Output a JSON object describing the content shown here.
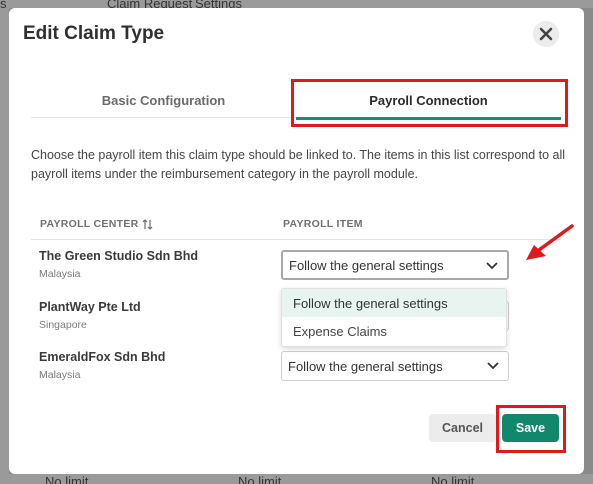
{
  "background": {
    "top_labels": [
      "s",
      "Claim Request",
      "Settings"
    ],
    "bottom_labels": [
      "No limit",
      "No limit",
      "No limit"
    ]
  },
  "modal": {
    "title": "Edit Claim Type",
    "close_icon": "close-icon"
  },
  "tabs": [
    {
      "label": "Basic Configuration",
      "active": false
    },
    {
      "label": "Payroll Connection",
      "active": true
    }
  ],
  "description": "Choose the payroll item this claim type should be linked to. The items in this list correspond to all payroll items under the reimbursement category in the payroll module.",
  "table": {
    "headers": {
      "payroll_center": "PAYROLL CENTER",
      "payroll_item": "PAYROLL ITEM"
    },
    "rows": [
      {
        "name": "The Green Studio Sdn Bhd",
        "country": "Malaysia",
        "value": "Follow the general settings"
      },
      {
        "name": "PlantWay Pte Ltd",
        "country": "Singapore",
        "value": ""
      },
      {
        "name": "EmeraldFox Sdn Bhd",
        "country": "Malaysia",
        "value": "Follow the general settings"
      }
    ]
  },
  "dropdown": {
    "options": [
      "Follow the general settings",
      "Expense Claims"
    ],
    "highlighted_index": 0
  },
  "buttons": {
    "cancel": "Cancel",
    "save": "Save"
  },
  "colors": {
    "accent": "#12876c",
    "annotation": "#e01a1a",
    "option_highlight": "#e7f4f0"
  }
}
